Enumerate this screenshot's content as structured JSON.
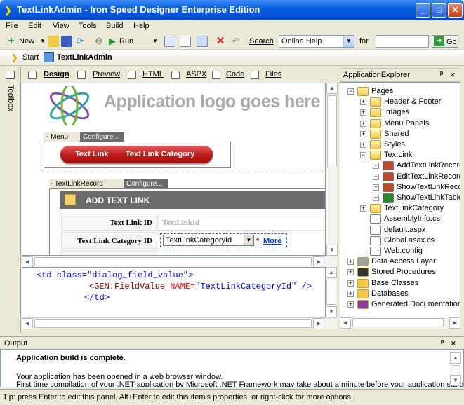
{
  "window": {
    "title": "TextLinkAdmin - Iron Speed Designer Enterprise Edition",
    "minimize": "_",
    "maximize": "□",
    "close": "✕"
  },
  "menu": [
    "File",
    "Edit",
    "View",
    "Tools",
    "Build",
    "Help"
  ],
  "toolbar": {
    "new_label": "New",
    "run_label": "Run",
    "search_label": "Search",
    "search_scope": "Online Help",
    "for_label": "for",
    "for_value": "",
    "go_label": "Go"
  },
  "breadcrumb": {
    "start": "Start",
    "current": "TextLinkAdmin"
  },
  "toolbox": {
    "label": "Toolbox"
  },
  "designer_tabs": [
    "Design",
    "Preview",
    "HTML",
    "ASPX",
    "Code",
    "Files"
  ],
  "design": {
    "logo_text": "Application logo goes here",
    "menu_panel_label": "- Menu",
    "configure_label": "Configure...",
    "menu_items": [
      "Text Link",
      "Text Link Category"
    ],
    "record_panel_label": "- TextLinkRecord",
    "record_configure_label": "Configure...",
    "add_header": "ADD TEXT LINK",
    "fields": [
      {
        "label": "Text Link ID",
        "value": "TextLinkId"
      },
      {
        "label": "Text Link Category ID",
        "value": "TextLinkCategoryId"
      }
    ],
    "required_mark": "*",
    "more_link": "More"
  },
  "code": {
    "line1_tag": "<td class=",
    "line1_attr": "\"dialog_field_value\"",
    "line1_end": ">",
    "line2_tag": "<GEN:FieldValue ",
    "line2_attrname": "NAME=",
    "line2_attr": "\"TextLinkCategoryId\"",
    "line2_end": " />",
    "line3": "</td>"
  },
  "explorer": {
    "title": "ApplicationExplorer",
    "pin": "ᵖ",
    "close": "×",
    "nodes": [
      {
        "label": "Pages",
        "pm": "−"
      },
      {
        "label": "Header & Footer",
        "pm": "+"
      },
      {
        "label": "Images",
        "pm": "+"
      },
      {
        "label": "Menu Panels",
        "pm": "+"
      },
      {
        "label": "Shared",
        "pm": "+"
      },
      {
        "label": "Styles",
        "pm": "+"
      },
      {
        "label": "TextLink",
        "pm": "−"
      },
      {
        "label": "AddTextLinkRecord",
        "pm": "+"
      },
      {
        "label": "EditTextLinkRecord",
        "pm": "+"
      },
      {
        "label": "ShowTextLinkRecord",
        "pm": "+"
      },
      {
        "label": "ShowTextLinkTable",
        "pm": "+"
      },
      {
        "label": "TextLinkCategory",
        "pm": "+"
      },
      {
        "label": "AssemblyInfo.cs",
        "pm": ""
      },
      {
        "label": "default.aspx",
        "pm": ""
      },
      {
        "label": "Global.asax.cs",
        "pm": ""
      },
      {
        "label": "Web.config",
        "pm": ""
      },
      {
        "label": "Data Access Layer",
        "pm": "+"
      },
      {
        "label": "Stored Procedures",
        "pm": "+"
      },
      {
        "label": "Base Classes",
        "pm": "+"
      },
      {
        "label": "Databases",
        "pm": "+"
      },
      {
        "label": "Generated Documentation",
        "pm": "+"
      }
    ]
  },
  "output": {
    "title": "Output",
    "line1": "Application build is complete.",
    "line2": "Your application has been opened in a web browser window.",
    "line3": "First time compilation of your .NET application by Microsoft .NET Framework may take about a minute before your application starts."
  },
  "status": "Tip: press Enter to edit this panel, Alt+Enter to edit this item's properties, or right-click for more options.",
  "colors": {
    "accent": "#0a5ee0",
    "logo_text": "#a9a9a9",
    "record_header": "#6b6b6b"
  }
}
